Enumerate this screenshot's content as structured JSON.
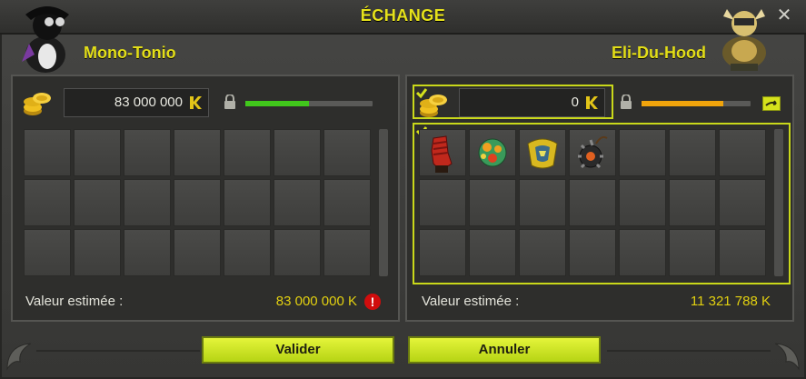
{
  "window": {
    "title": "ÉCHANGE",
    "close_glyph": "✕"
  },
  "left": {
    "player_name": "Mono-Tonio",
    "kamas_value": "83 000 000",
    "kama_icon": "kama-icon",
    "progress_color": "#41c81c",
    "progress_fraction": 0.5,
    "estimate_label": "Valeur estimée :",
    "estimate_value": "83 000 000 K",
    "warning_glyph": "!",
    "slots": 21
  },
  "right": {
    "player_name": "Eli-Du-Hood",
    "kamas_value": "0",
    "kama_icon": "kama-icon",
    "progress_color": "#f0a40c",
    "progress_fraction": 0.75,
    "estimate_label": "Valeur estimée :",
    "estimate_value": "11 321 788 K",
    "slots": 21,
    "items": [
      "red-gauntlet-icon",
      "green-orb-creature-icon",
      "gold-armor-piece-icon",
      "spiked-ball-icon"
    ]
  },
  "buttons": {
    "validate": "Valider",
    "cancel": "Annuler"
  },
  "colors": {
    "accent": "#e3de18",
    "button": "#c8e020",
    "highlight": "#c9d81a"
  }
}
